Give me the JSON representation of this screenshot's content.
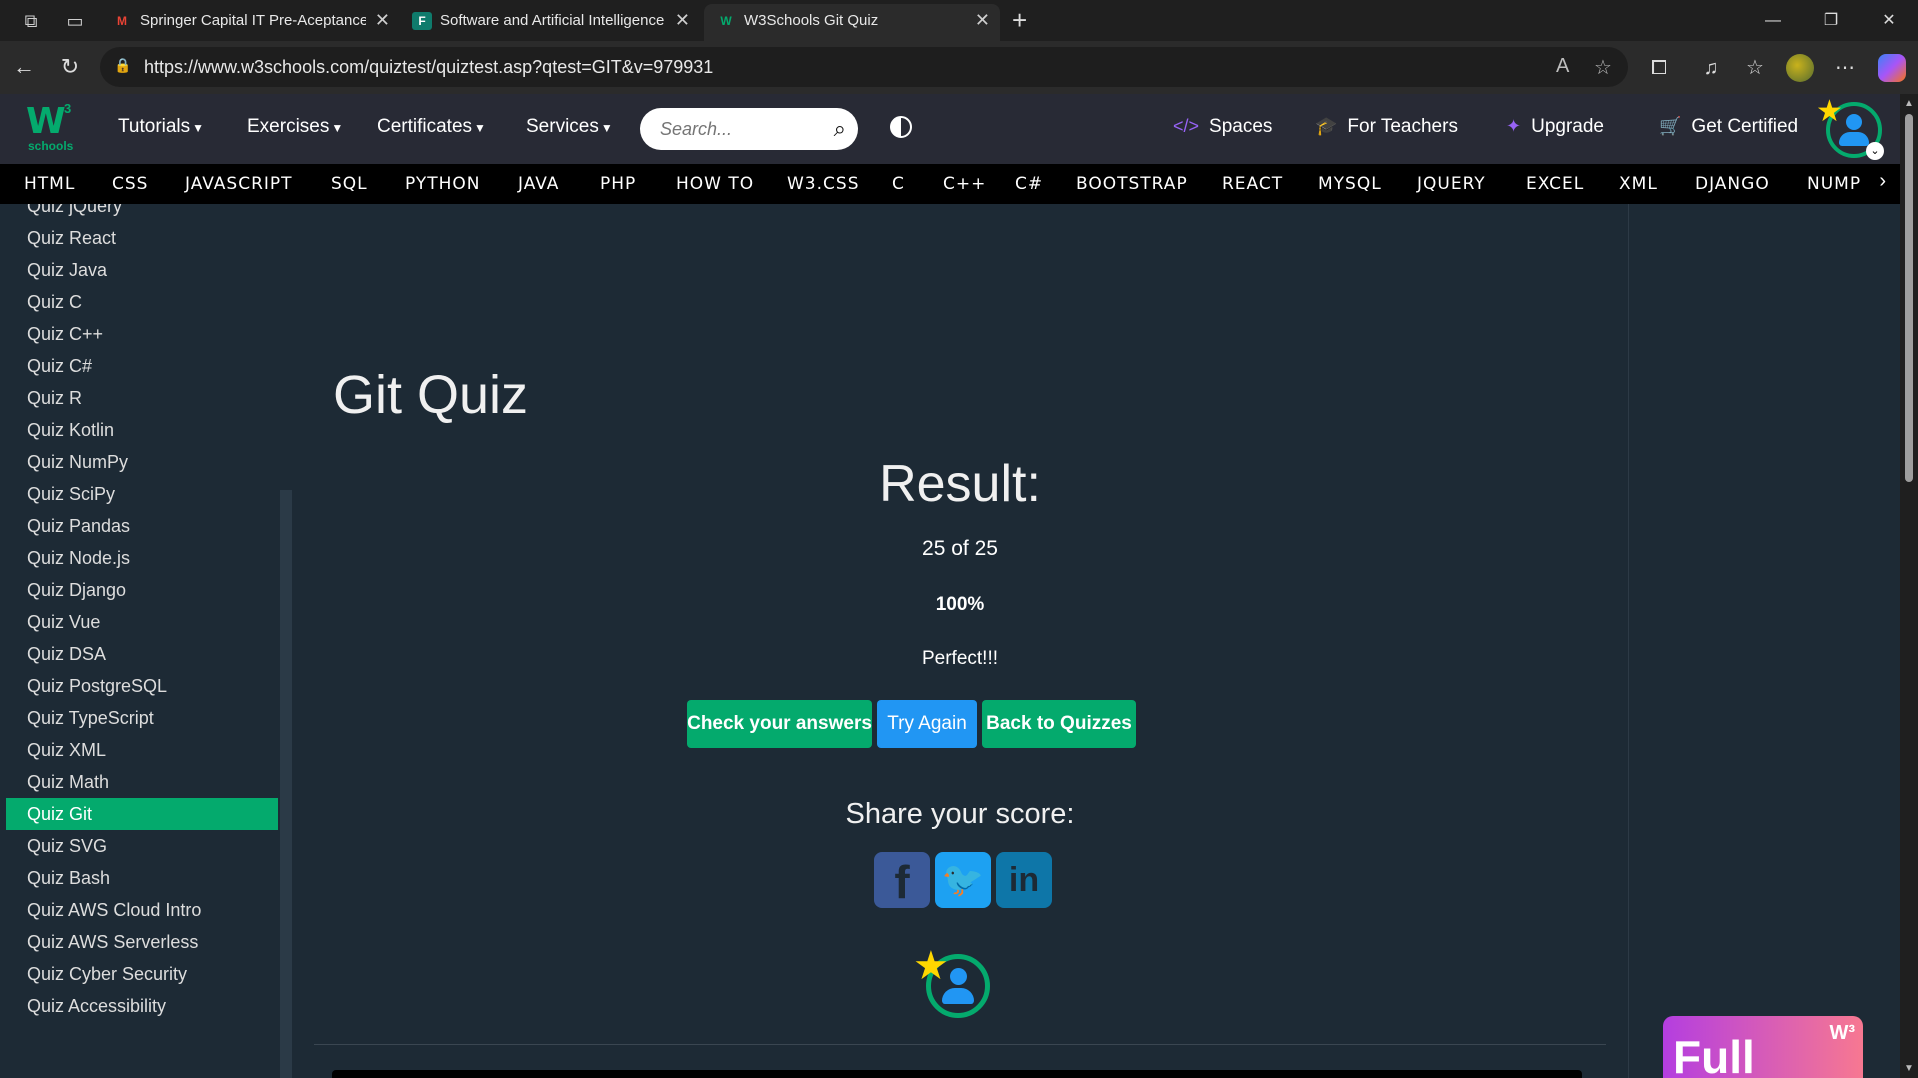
{
  "browser": {
    "tabs": [
      {
        "title": "Springer Capital IT Pre-Aceptance",
        "favicon": "gmail-icon"
      },
      {
        "title": "Software and Artificial Intelligence",
        "favicon": "forms-icon"
      },
      {
        "title": "W3Schools Git Quiz",
        "favicon": "w3schools-icon"
      }
    ],
    "url": "https://www.w3schools.com/quiztest/quiztest.asp?qtest=GIT&v=979931"
  },
  "w3": {
    "logo": {
      "main": "W",
      "sup": "3",
      "sub": "schools"
    },
    "menus": [
      "Tutorials",
      "Exercises",
      "Certificates",
      "Services"
    ],
    "search_placeholder": "Search...",
    "right_links": [
      "Spaces",
      "For Teachers",
      "Upgrade",
      "Get Certified"
    ],
    "subnav": [
      "HTML",
      "CSS",
      "JAVASCRIPT",
      "SQL",
      "PYTHON",
      "JAVA",
      "PHP",
      "HOW TO",
      "W3.CSS",
      "C",
      "C++",
      "C#",
      "BOOTSTRAP",
      "REACT",
      "MYSQL",
      "JQUERY",
      "EXCEL",
      "XML",
      "DJANGO",
      "NUMP"
    ]
  },
  "sidebar": {
    "items": [
      "Quiz jQuery",
      "Quiz React",
      "Quiz Java",
      "Quiz C",
      "Quiz C++",
      "Quiz C#",
      "Quiz R",
      "Quiz Kotlin",
      "Quiz NumPy",
      "Quiz SciPy",
      "Quiz Pandas",
      "Quiz Node.js",
      "Quiz Django",
      "Quiz Vue",
      "Quiz DSA",
      "Quiz PostgreSQL",
      "Quiz TypeScript",
      "Quiz XML",
      "Quiz Math",
      "Quiz Git",
      "Quiz SVG",
      "Quiz Bash",
      "Quiz AWS Cloud Intro",
      "Quiz AWS Serverless",
      "Quiz Cyber Security",
      "Quiz Accessibility"
    ],
    "active": "Quiz Git"
  },
  "main": {
    "title": "Git Quiz",
    "result_title": "Result:",
    "score": "25 of 25",
    "percent": "100%",
    "verdict": "Perfect!!!",
    "buttons": {
      "check": "Check your answers",
      "retry": "Try Again",
      "back": "Back to Quizzes"
    },
    "share_title": "Share your score:"
  },
  "ad": {
    "text": "Full",
    "logo": "w3schools"
  },
  "colors": {
    "accent": "#04aa6d",
    "blue": "#2196f3",
    "bg": "#1d2a35",
    "nav": "#282a35"
  }
}
